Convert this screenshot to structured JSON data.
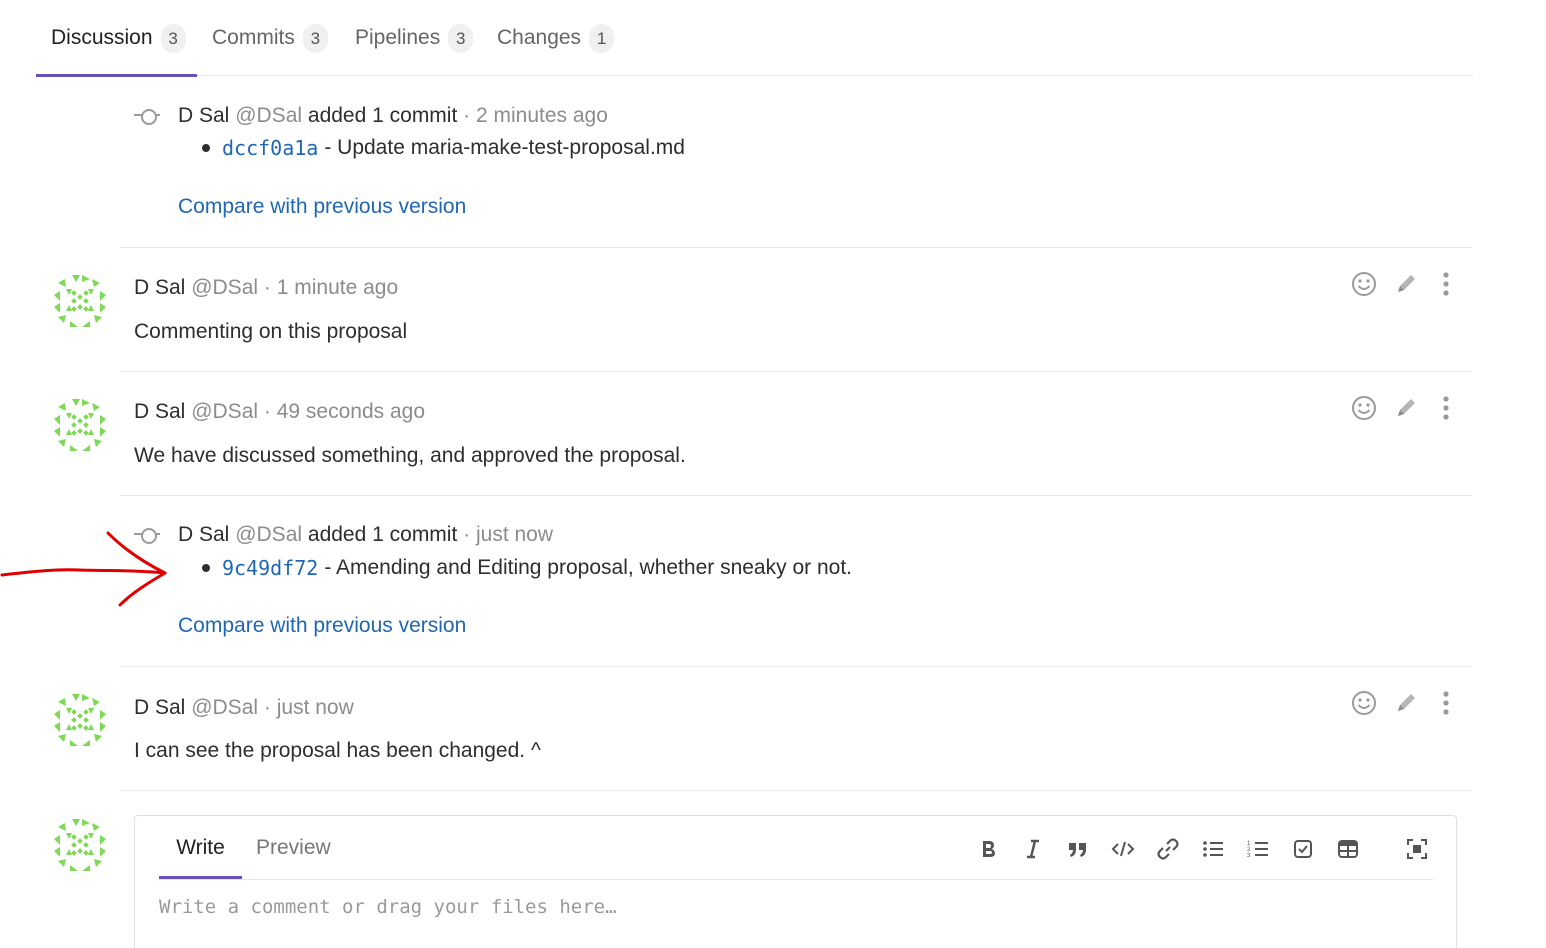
{
  "tabs": [
    {
      "label": "Discussion",
      "count": "3"
    },
    {
      "label": "Commits",
      "count": "3"
    },
    {
      "label": "Pipelines",
      "count": "3"
    },
    {
      "label": "Changes",
      "count": "1"
    }
  ],
  "system_notes": [
    {
      "author": "D Sal",
      "handle": "@DSal",
      "action": "added 1 commit",
      "time": "· 2 minutes ago",
      "sha": "dccf0a1a",
      "message": "- Update maria-make-test-proposal.md",
      "compare": "Compare with previous version"
    },
    {
      "author": "D Sal",
      "handle": "@DSal",
      "action": "added 1 commit",
      "time": "· just now",
      "sha": "9c49df72",
      "message": "- Amending and Editing proposal, whether sneaky or not.",
      "compare": "Compare with previous version"
    }
  ],
  "comments": [
    {
      "author": "D Sal",
      "handle": "@DSal",
      "time": "· 1 minute ago",
      "body": "Commenting on this proposal"
    },
    {
      "author": "D Sal",
      "handle": "@DSal",
      "time": "· 49 seconds ago",
      "body": "We have discussed something, and approved the proposal."
    },
    {
      "author": "D Sal",
      "handle": "@DSal",
      "time": "· just now",
      "body": "I can see the proposal has been changed. ^"
    }
  ],
  "editor": {
    "write_label": "Write",
    "preview_label": "Preview",
    "placeholder": "Write a comment or drag your files here…",
    "toolbar": [
      "bold-icon",
      "italic-icon",
      "quote-icon",
      "code-icon",
      "link-icon",
      "bullet-list-icon",
      "numbered-list-icon",
      "task-list-icon",
      "table-icon",
      "fullscreen-icon"
    ]
  },
  "colors": {
    "accent": "#6b4fbb",
    "link": "#1f66b3",
    "avatar": "#7ed957",
    "annotation": "#e00000"
  }
}
